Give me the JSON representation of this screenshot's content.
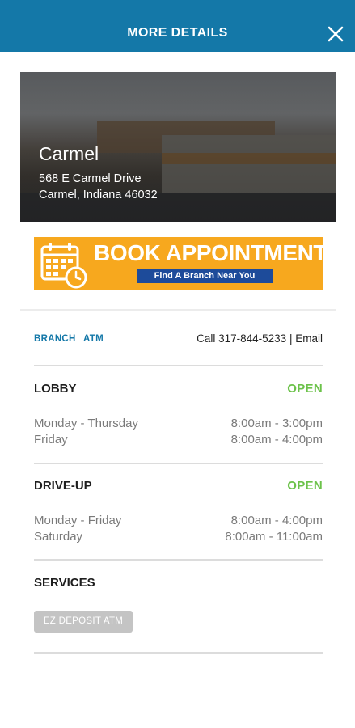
{
  "header": {
    "title": "MORE DETAILS",
    "close_icon": "close-icon"
  },
  "branch": {
    "name": "Carmel",
    "address_line1": "568 E Carmel Drive",
    "address_line2": "Carmel, Indiana 46032"
  },
  "banner": {
    "title": "BOOK APPOINTMENT",
    "subtitle": "Find A Branch Near You",
    "icon": "calendar-clock-icon"
  },
  "tabs": {
    "branch": "BRANCH",
    "atm": "ATM"
  },
  "contact": {
    "call": "Call 317-844-5233",
    "separator": "|",
    "email": "Email"
  },
  "lobby": {
    "title": "LOBBY",
    "status": "OPEN",
    "rows": [
      {
        "days": "Monday - Thursday",
        "hours": "8:00am - 3:00pm"
      },
      {
        "days": "Friday",
        "hours": "8:00am - 4:00pm"
      }
    ]
  },
  "drive_up": {
    "title": "DRIVE-UP",
    "status": "OPEN",
    "rows": [
      {
        "days": "Monday - Friday",
        "hours": "8:00am - 4:00pm"
      },
      {
        "days": "Saturday",
        "hours": "8:00am - 11:00am"
      }
    ]
  },
  "services": {
    "title": "SERVICES",
    "items": [
      "EZ DEPOSIT ATM"
    ]
  },
  "colors": {
    "header": "#1478a8",
    "open": "#6cc24a",
    "banner": "#f7a81e",
    "banner_sub": "#1d4b9a",
    "link": "#1478a8"
  }
}
